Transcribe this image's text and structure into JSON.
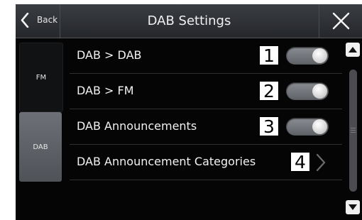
{
  "header": {
    "back_label": "Back",
    "title": "DAB Settings"
  },
  "sidebar": {
    "tabs": [
      {
        "label": "FM",
        "selected": false
      },
      {
        "label": "DAB",
        "selected": true
      }
    ]
  },
  "settings": [
    {
      "label": "DAB > DAB",
      "callout": "1",
      "control": "toggle",
      "on": true
    },
    {
      "label": "DAB > FM",
      "callout": "2",
      "control": "toggle",
      "on": true
    },
    {
      "label": "DAB Announcements",
      "callout": "3",
      "control": "toggle",
      "on": true
    },
    {
      "label": "DAB Announcement Categories",
      "callout": "4",
      "control": "chevron-right-icon"
    }
  ],
  "icons": [
    "chevron-left-icon",
    "close-icon",
    "chevron-right-icon",
    "scroll-up-icon",
    "scroll-down-icon"
  ],
  "colors": {
    "background": "#050505",
    "toggle_on": "#8b8e94",
    "selected_tab": "#6d7076"
  }
}
